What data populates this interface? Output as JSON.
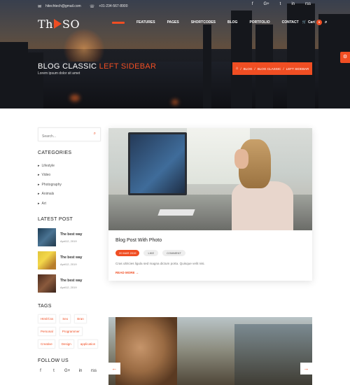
{
  "topbar": {
    "email": "hitechtech@gmail.com",
    "phone": "+01-234-567-8900",
    "social": [
      "f",
      "G+",
      "t",
      "in",
      "rss"
    ]
  },
  "logo": {
    "left": "Th",
    "right": "SO"
  },
  "nav": {
    "items": [
      "FEATURES",
      "PAGES",
      "SHORTCODES",
      "BLOG",
      "PORTFOLIO",
      "CONTACT"
    ],
    "cart_label": "Cart",
    "cart_count": "0"
  },
  "hero": {
    "title_main": "BLOG CLASSIC",
    "title_accent": "LEFT SIDEBAR",
    "subtitle": "Lorem ipsum dolor sit amet",
    "breadcrumb": [
      "BLOG",
      "BLOG CLASSIC",
      "LEFT SIDEBAR"
    ]
  },
  "sidebar": {
    "search_placeholder": "Search...",
    "categories_title": "CATEGORIES",
    "categories": [
      "Lifestyle",
      "Video",
      "Photography",
      "Animals",
      "Art"
    ],
    "latest_title": "LATEST POST",
    "latest_posts": [
      {
        "title": "The best way",
        "date": "April12, 2019"
      },
      {
        "title": "The best way",
        "date": "April12, 2019"
      },
      {
        "title": "The best way",
        "date": "April12, 2019"
      }
    ],
    "tags_title": "TAGS",
    "tags": [
      "Html/Css",
      "Seo",
      "Bran",
      "Personal",
      "Programmer",
      "Creative",
      "Design",
      "application"
    ],
    "follow_title": "FOLLOW US",
    "follow_icons": [
      "f",
      "t",
      "G+",
      "in",
      "rss"
    ]
  },
  "post": {
    "title": "Blog Post With Photo",
    "date": "20 MAR 2019",
    "likes": "LIKE",
    "comments": "COMMENT",
    "excerpt": "Cras ultricies ligula sed magna dictum porta. Quisque velit nisi.",
    "read_more": "READ MORE"
  },
  "colors": {
    "accent": "#f04e23"
  }
}
